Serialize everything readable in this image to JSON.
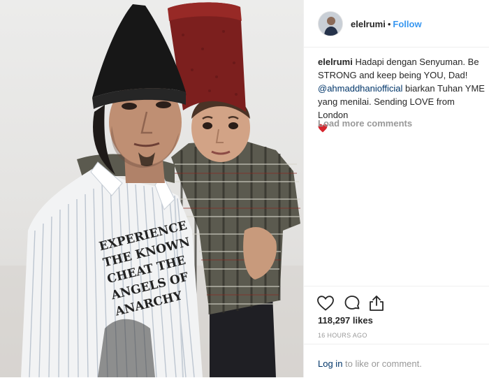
{
  "post": {
    "username": "elelrumi",
    "separator": "•",
    "follow_label": "Follow",
    "caption": {
      "user": "elelrumi",
      "text_1": "Hadapi dengan Senyuman. Be STRONG and keep being YOU, Dad!",
      "mention": "@ahmaddhaniofficial",
      "text_2": "biarkan Tuhan YME yang menilai. Sending LOVE from London"
    },
    "load_more_label": "Load more comments",
    "likes": "118,297 likes",
    "time": "16 HOURS AGO",
    "footer": {
      "login_label": "Log in",
      "rest": "to like or comment."
    }
  },
  "photo": {
    "shirt_print": [
      "EXPERIENCE",
      "THE KNOWN",
      "CHEAT THE",
      "ANGELS OF",
      "ANARCHY"
    ]
  },
  "icons": {
    "like": "heart-outline",
    "comment": "speech-bubble-outline",
    "share": "share-arrow",
    "caption_emoji": "red-heart"
  },
  "colors": {
    "link": "#3897f0",
    "mention": "#003569",
    "muted": "#999999",
    "text": "#262626",
    "border": "#efefef"
  }
}
